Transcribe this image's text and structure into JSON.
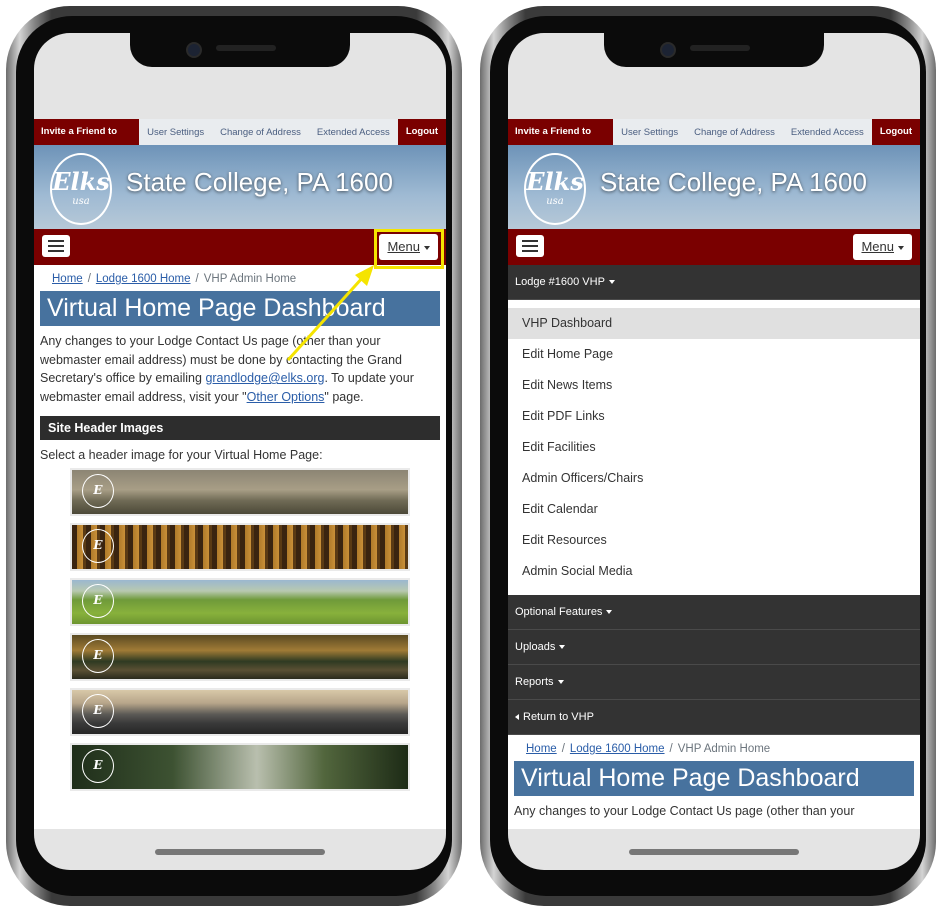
{
  "topbar": {
    "invite": "Invite a Friend to Join",
    "user_settings": "User Settings",
    "change_address": "Change of Address",
    "extended_access": "Extended Access",
    "logout": "Logout"
  },
  "site": {
    "title": "State College, PA 1600",
    "logo_text": "Elks",
    "logo_sub": "usa"
  },
  "nav": {
    "menu_label": "Menu"
  },
  "breadcrumb": {
    "home": "Home",
    "lodge": "Lodge 1600 Home",
    "current": "VHP Admin Home",
    "separator": "/"
  },
  "page": {
    "title": "Virtual Home Page Dashboard",
    "para_1": "Any changes to your Lodge Contact Us page (other than your webmaster email address) must be done by contacting the Grand Secretary's office by emailing ",
    "email_link": "grandlodge@elks.org",
    "para_2": ". To update your webmaster email address, visit your \"",
    "other_options_link": "Other Options",
    "para_3": "\" page.",
    "para_short": "Any changes to your Lodge Contact Us page (other than your",
    "section_header": "Site Header Images",
    "select_text": "Select a header image for your Virtual Home Page:"
  },
  "menu": {
    "lodge_vhp": "Lodge #1600 VHP",
    "items": [
      "VHP Dashboard",
      "Edit Home Page",
      "Edit News Items",
      "Edit PDF Links",
      "Edit Facilities",
      "Admin Officers/Chairs",
      "Edit Calendar",
      "Edit Resources",
      "Admin Social Media"
    ],
    "optional_features": "Optional Features",
    "uploads": "Uploads",
    "reports": "Reports",
    "return": "Return to VHP"
  },
  "colors": {
    "brand_red": "#7a0000",
    "title_blue": "#47729e",
    "dark_bar": "#2d2d2d",
    "link_blue": "#2a5da8",
    "highlight_yellow": "#f5e400"
  },
  "header_images": [
    "elk-meadow",
    "forest",
    "green-hills",
    "autumn-stream",
    "mountains",
    "forest-mist"
  ]
}
